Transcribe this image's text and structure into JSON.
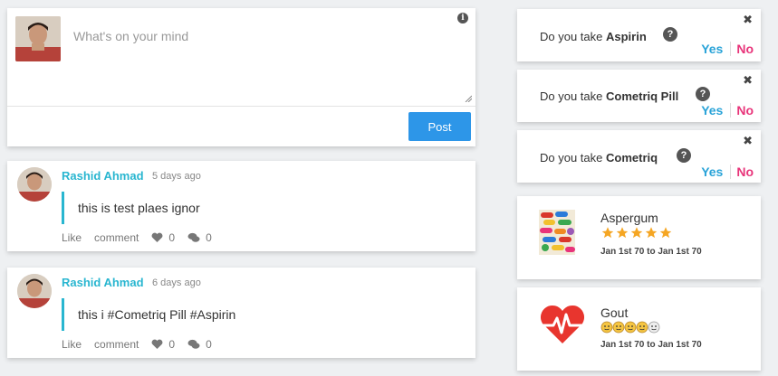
{
  "composer": {
    "placeholder": "What's on your mind",
    "post_label": "Post"
  },
  "posts": [
    {
      "author": "Rashid Ahmad",
      "time": "5 days ago",
      "text": "this is test plaes ignor",
      "like_label": "Like",
      "comment_label": "comment",
      "likes": "0",
      "comments": "0"
    },
    {
      "author": "Rashid Ahmad",
      "time": "6 days ago",
      "text": "this i #Cometriq Pill #Aspirin",
      "like_label": "Like",
      "comment_label": "comment",
      "likes": "0",
      "comments": "0"
    }
  ],
  "questions": [
    {
      "prefix": "Do you take ",
      "drug": "Aspirin",
      "yes": "Yes",
      "no": "No"
    },
    {
      "prefix": "Do you take ",
      "drug": "Cometriq Pill",
      "yes": "Yes",
      "no": "No"
    },
    {
      "prefix": "Do you take ",
      "drug": "Cometriq",
      "yes": "Yes",
      "no": "No"
    }
  ],
  "meds": [
    {
      "name": "Aspergum",
      "rating": 5,
      "rating_max": 5,
      "dates": "Jan 1st 70 to Jan 1st 70",
      "icon": "pills-image"
    },
    {
      "name": "Gout",
      "mood_level": 4,
      "mood_max": 5,
      "dates": "Jan 1st 70 to Jan 1st 70",
      "icon": "heartbeat-icon"
    }
  ],
  "colors": {
    "accent": "#29b6d0",
    "post_button": "#2d96e8",
    "yes": "#29a3d8",
    "no": "#e8347a",
    "heart": "#e8352e",
    "star": "#f5a623"
  }
}
